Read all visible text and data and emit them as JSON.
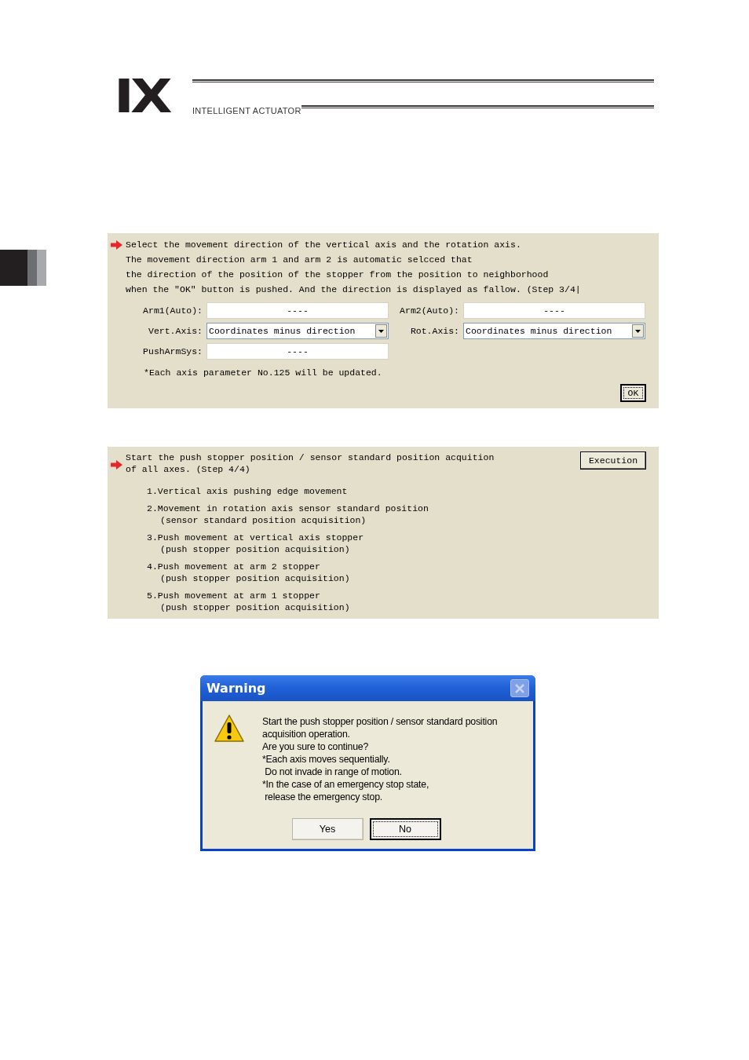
{
  "header": {
    "logo": "IX",
    "tagline": "INTELLIGENT ACTUATOR"
  },
  "step3_panel": {
    "instructions": [
      "Select the movement direction of the vertical axis and the rotation axis.",
      "The movement direction arm 1 and arm 2 is automatic selcced that",
      "the direction of the position of the stopper from the position to neighborhood",
      "when the \"OK\" button is pushed. And the direction is displayed as fallow. (Step 3/4|"
    ],
    "fields": [
      {
        "label": "Arm1(Auto):",
        "value": "----",
        "kind": "text"
      },
      {
        "label": "Arm2(Auto):",
        "value": "----",
        "kind": "text"
      },
      {
        "label": "Vert.Axis:",
        "value": "Coordinates minus direction",
        "kind": "dropdown"
      },
      {
        "label": "Rot.Axis:",
        "value": "Coordinates minus direction",
        "kind": "dropdown"
      },
      {
        "label": "PushArmSys:",
        "value": "----",
        "kind": "text"
      }
    ],
    "note": "*Each axis parameter No.125 will be updated.",
    "ok_button": "OK"
  },
  "step4_panel": {
    "instructions": [
      "Start the push stopper position / sensor standard position acquition",
      "of all axes. (Step 4/4)"
    ],
    "execute_button": "Execution",
    "steps": [
      {
        "title": "1.Vertical axis pushing edge movement"
      },
      {
        "title": "2.Movement in rotation axis sensor standard position",
        "detail": "(sensor standard position acquisition)"
      },
      {
        "title": "3.Push movement at vertical axis stopper",
        "detail": "(push stopper position acquisition)"
      },
      {
        "title": "4.Push movement at arm 2 stopper",
        "detail": "(push stopper position acquisition)"
      },
      {
        "title": "5.Push movement at arm 1 stopper",
        "detail": "(push stopper position acquisition)"
      }
    ]
  },
  "warning_dialog": {
    "title": "Warning",
    "message": [
      "Start the push stopper position / sensor standard position",
      "acquisition operation.",
      "Are you sure to continue?",
      "*Each axis moves sequentially.",
      " Do not invade in range of motion.",
      "*In the case of an emergency stop state,",
      " release the emergency stop."
    ],
    "buttons": [
      {
        "label": "Yes",
        "selected": false
      },
      {
        "label": "No",
        "selected": true
      }
    ]
  }
}
